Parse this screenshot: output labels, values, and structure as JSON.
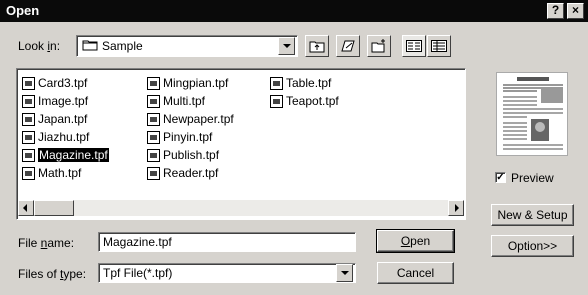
{
  "window": {
    "title": "Open",
    "help_button": "?",
    "close_button": "×"
  },
  "look_in": {
    "label_pre": "Look ",
    "label_hotkey": "i",
    "label_post": "n:",
    "value": "Sample",
    "folder_icon": "folder-icon",
    "toolbar_icons": [
      "up-folder-icon",
      "favorites-icon",
      "new-folder-icon",
      "list-view-icon",
      "details-view-icon"
    ]
  },
  "files": {
    "columns": [
      [
        "Card3.tpf",
        "Image.tpf",
        "Japan.tpf",
        "Jiazhu.tpf",
        "Magazine.tpf",
        "Math.tpf"
      ],
      [
        "Mingpian.tpf",
        "Multi.tpf",
        "Newpaper.tpf",
        "Pinyin.tpf",
        "Publish.tpf",
        "Reader.tpf"
      ],
      [
        "Table.tpf",
        "Teapot.tpf"
      ]
    ],
    "selected": "Magazine.tpf"
  },
  "file_name": {
    "label_pre": "File ",
    "label_hotkey": "n",
    "label_post": "ame:",
    "value": "Magazine.tpf"
  },
  "file_type": {
    "label_pre": "Files of ",
    "label_hotkey": "t",
    "label_post": "ype:",
    "value": "Tpf File(*.tpf)"
  },
  "buttons": {
    "open_hotkey": "O",
    "open_rest": "pen",
    "cancel": "Cancel",
    "new_setup": "New & Setup",
    "options": "Option>>"
  },
  "preview": {
    "label": "Preview",
    "checked": "✓"
  }
}
